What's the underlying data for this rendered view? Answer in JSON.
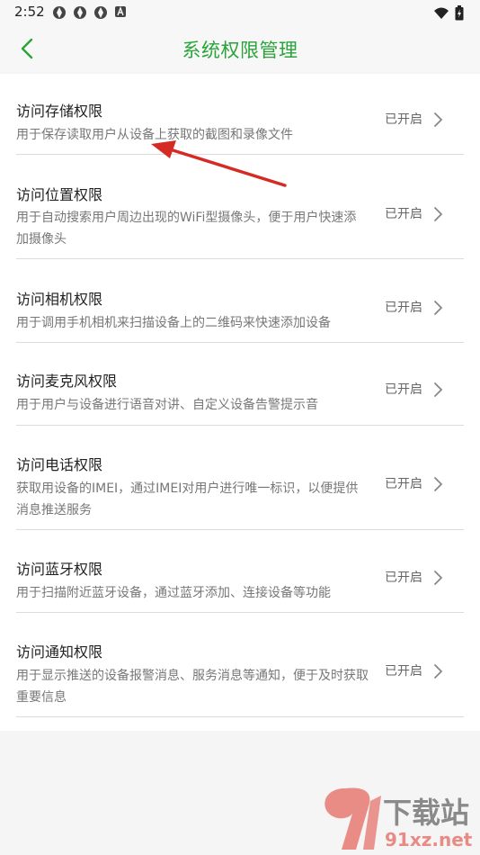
{
  "status_bar": {
    "time": "2:52",
    "icons": [
      "notification-icon",
      "notification-icon",
      "notification-icon",
      "a-icon",
      "wifi-icon",
      "battery-icon"
    ]
  },
  "header": {
    "title": "系统权限管理",
    "back_icon": "chevron-left-icon",
    "accent_color": "#2aa33a"
  },
  "permissions": [
    {
      "title": "访问存储权限",
      "desc": "用于保存读取用户从设备上获取的截图和录像文件",
      "status": "已开启"
    },
    {
      "title": "访问位置权限",
      "desc": "用于自动搜索用户周边出现的WiFi型摄像头，便于用户快速添加摄像头",
      "status": "已开启"
    },
    {
      "title": "访问相机权限",
      "desc": "用于调用手机相机来扫描设备上的二维码来快速添加设备",
      "status": "已开启"
    },
    {
      "title": "访问麦克风权限",
      "desc": "用于用户与设备进行语音对讲、自定义设备告警提示音",
      "status": "已开启"
    },
    {
      "title": "访问电话权限",
      "desc": "获取用设备的IMEI，通过IMEI对用户进行唯一标识，以便提供消息推送服务",
      "status": "已开启"
    },
    {
      "title": "访问蓝牙权限",
      "desc": "用于扫描附近蓝牙设备，通过蓝牙添加、连接设备等功能",
      "status": "已开启"
    },
    {
      "title": "访问通知权限",
      "desc": "用于显示推送的设备报警消息、服务消息等通知，便于及时获取重要信息",
      "status": "已开启"
    }
  ],
  "watermark": {
    "brand": "下载站",
    "site": "91xz.net"
  }
}
